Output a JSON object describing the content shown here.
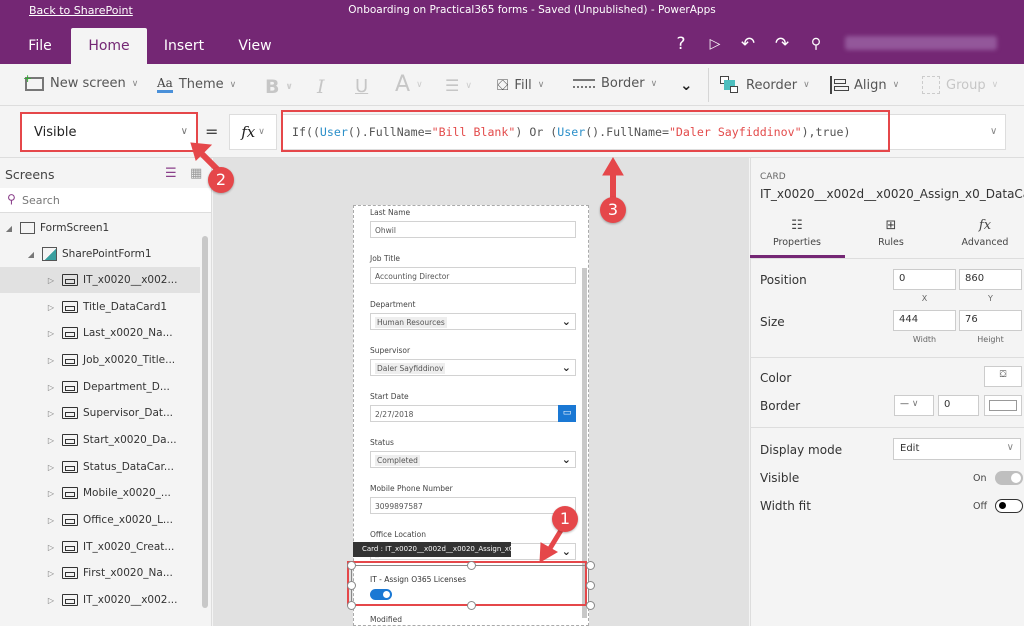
{
  "titlebar": {
    "back_link": "Back to SharePoint",
    "app_title": "Onboarding on Practical365 forms - Saved (Unpublished) - PowerApps"
  },
  "menu": {
    "tabs": [
      {
        "label": "File"
      },
      {
        "label": "Home",
        "active": true
      },
      {
        "label": "Insert"
      },
      {
        "label": "View"
      }
    ],
    "icons": [
      "help-icon",
      "play-icon",
      "undo-icon",
      "redo-icon",
      "user-icon"
    ]
  },
  "ribbon": {
    "new_screen": "New screen",
    "theme": "Theme",
    "bold": "B",
    "italic": "I",
    "underline": "U",
    "font_size": "A",
    "fill": "Fill",
    "border": "Border",
    "reorder": "Reorder",
    "align": "Align",
    "group": "Group"
  },
  "formula_bar": {
    "property": "Visible",
    "equals": "=",
    "fx": "fx",
    "formula_parts": [
      {
        "t": "If((",
        "c": "kw"
      },
      {
        "t": "User",
        "c": "fn"
      },
      {
        "t": "().FullName=",
        "c": "kw"
      },
      {
        "t": "\"Bill Blank\"",
        "c": "str"
      },
      {
        "t": ") Or (",
        "c": "kw"
      },
      {
        "t": "User",
        "c": "fn"
      },
      {
        "t": "().FullName=",
        "c": "kw"
      },
      {
        "t": "\"Daler Sayfiddinov\"",
        "c": "str"
      },
      {
        "t": "),true)",
        "c": "kw"
      }
    ]
  },
  "left_panel": {
    "title": "Screens",
    "search_placeholder": "Search",
    "tree": [
      {
        "label": "FormScreen1",
        "level": 0,
        "expanded": true,
        "icon": "screen-icon"
      },
      {
        "label": "SharePointForm1",
        "level": 1,
        "expanded": true,
        "icon": "form-icon"
      },
      {
        "label": "IT_x0020__x002...",
        "level": 2,
        "selected": true
      },
      {
        "label": "Title_DataCard1",
        "level": 2
      },
      {
        "label": "Last_x0020_Na...",
        "level": 2
      },
      {
        "label": "Job_x0020_Title...",
        "level": 2
      },
      {
        "label": "Department_D...",
        "level": 2
      },
      {
        "label": "Supervisor_Dat...",
        "level": 2
      },
      {
        "label": "Start_x0020_Da...",
        "level": 2
      },
      {
        "label": "Status_DataCar...",
        "level": 2
      },
      {
        "label": "Mobile_x0020_...",
        "level": 2
      },
      {
        "label": "Office_x0020_L...",
        "level": 2
      },
      {
        "label": "IT_x0020_Creat...",
        "level": 2
      },
      {
        "label": "First_x0020_Na...",
        "level": 2
      },
      {
        "label": "IT_x0020__x002...",
        "level": 2
      }
    ]
  },
  "form": {
    "fields": [
      {
        "label": "Last Name",
        "value": "Ohwil",
        "type": "text"
      },
      {
        "label": "Job Title",
        "value": "Accounting Director",
        "type": "text"
      },
      {
        "label": "Department",
        "value": "Human Resources",
        "type": "dropdown"
      },
      {
        "label": "Supervisor",
        "value": "Daler Sayfiddinov",
        "type": "dropdown"
      },
      {
        "label": "Start Date",
        "value": "2/27/2018",
        "type": "date"
      },
      {
        "label": "Status",
        "value": "Completed",
        "type": "dropdown"
      },
      {
        "label": "Mobile Phone Number",
        "value": "3099897587",
        "type": "text"
      },
      {
        "label": "Office Location",
        "value": "",
        "type": "dropdown"
      }
    ],
    "tooltip": "Card : IT_x0020__x002d__x0020_Assign_x0",
    "selected_card_label": "IT - Assign O365 Licenses",
    "selected_card_toggle_on": true,
    "next_label": "Modified"
  },
  "annotations": [
    "1",
    "2",
    "3"
  ],
  "right_panel": {
    "type": "CARD",
    "name": "IT_x0020__x002d__x0020_Assign_x0_DataCa",
    "tabs": [
      {
        "label": "Properties",
        "active": true
      },
      {
        "label": "Rules"
      },
      {
        "label": "Advanced"
      }
    ],
    "position": {
      "label": "Position",
      "x": "0",
      "y": "860",
      "x_label": "X",
      "y_label": "Y"
    },
    "size": {
      "label": "Size",
      "width": "444",
      "height": "76",
      "width_label": "Width",
      "height_label": "Height"
    },
    "color_label": "Color",
    "border_label": "Border",
    "border_width": "0",
    "display_mode": {
      "label": "Display mode",
      "value": "Edit"
    },
    "visible": {
      "label": "Visible",
      "state": "On"
    },
    "width_fit": {
      "label": "Width fit",
      "state": "Off"
    }
  }
}
